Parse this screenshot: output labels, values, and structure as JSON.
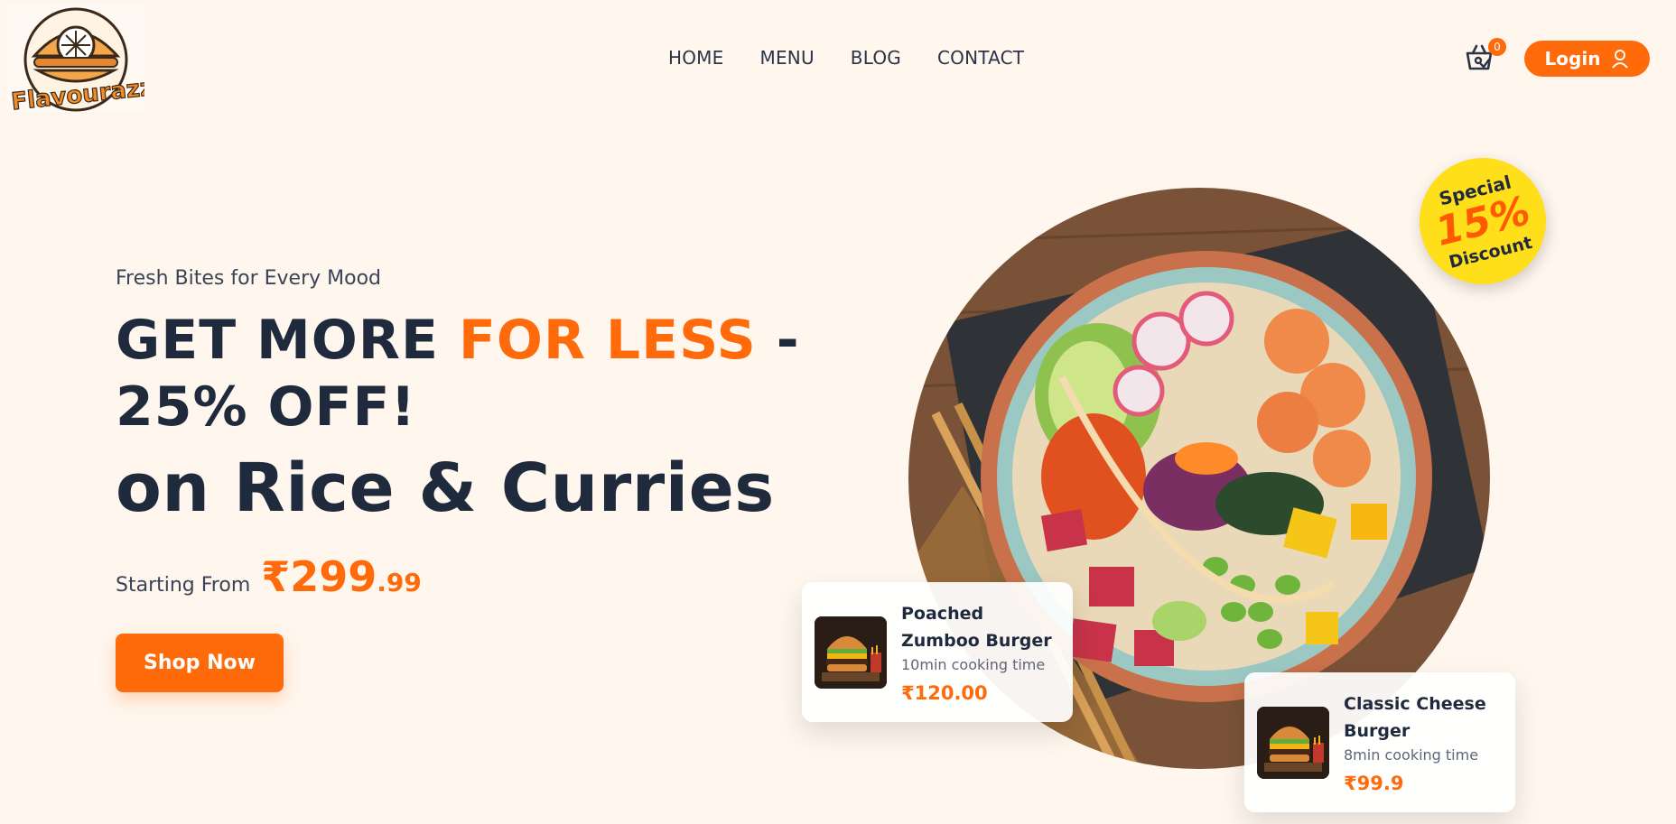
{
  "brand": {
    "logo_text": "Flavourazzi"
  },
  "nav": {
    "items": [
      {
        "label": "HOME"
      },
      {
        "label": "MENU"
      },
      {
        "label": "BLOG"
      },
      {
        "label": "CONTACT"
      }
    ]
  },
  "cart": {
    "count": "0",
    "icon": "shopping-basket-icon"
  },
  "login": {
    "label": "Login",
    "icon": "user-icon"
  },
  "hero": {
    "tagline": "Fresh Bites for Every Mood",
    "headline_part1": "GET MORE ",
    "headline_highlight": "FOR LESS",
    "headline_part2": " - 25% OFF!",
    "subheadline": "on Rice & Curries",
    "price_label": "Starting From",
    "price_main": "₹299",
    "price_cents": ".99",
    "cta_label": "Shop Now"
  },
  "discount_badge": {
    "top": "Special",
    "value": "15%",
    "bottom": "Discount"
  },
  "products": [
    {
      "name": "Poached Zumboo Burger",
      "time": "10min cooking time",
      "price": "₹120.00"
    },
    {
      "name": "Classic Cheese Burger",
      "time": "8min cooking time",
      "price": "₹99.9"
    }
  ],
  "colors": {
    "background": "#fff6ee",
    "accent": "#ff6b0a",
    "text_dark": "#1f2a3d",
    "badge_yellow": "#ffde1a"
  }
}
